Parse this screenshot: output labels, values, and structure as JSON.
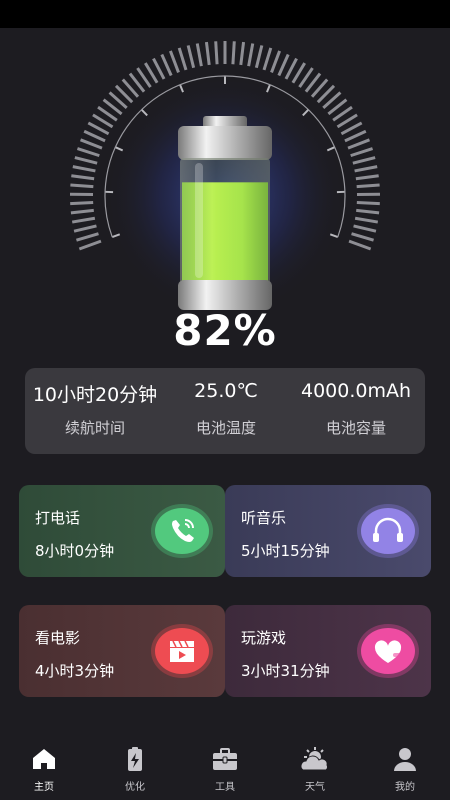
{
  "battery": {
    "percent_label": "82%",
    "level": 0.82
  },
  "stats": [
    {
      "value": "10小时20分钟",
      "label": "续航时间"
    },
    {
      "value": "25.0℃",
      "label": "电池温度"
    },
    {
      "value": "4000.0mAh",
      "label": "电池容量"
    }
  ],
  "cards": [
    {
      "title": "打电话",
      "time": "8小时0分钟",
      "icon": "phone-icon"
    },
    {
      "title": "听音乐",
      "time": "5小时15分钟",
      "icon": "headphones-icon"
    },
    {
      "title": "看电影",
      "time": "4小时3分钟",
      "icon": "clapperboard-icon"
    },
    {
      "title": "玩游戏",
      "time": "3小时31分钟",
      "icon": "heart-icon"
    }
  ],
  "nav": [
    {
      "label": "主页",
      "icon": "home-icon",
      "active": true
    },
    {
      "label": "优化",
      "icon": "battery-bolt-icon",
      "active": false
    },
    {
      "label": "工具",
      "icon": "toolbox-icon",
      "active": false
    },
    {
      "label": "天气",
      "icon": "weather-icon",
      "active": false
    },
    {
      "label": "我的",
      "icon": "user-icon",
      "active": false
    }
  ],
  "colors": {
    "background": "#1d1c21",
    "panel": "#3a393e",
    "battery_green": "#9be035",
    "accent_call": "#4ec27a",
    "accent_music": "#8a7be0",
    "accent_movie": "#e8474d",
    "accent_game": "#e8479a"
  }
}
